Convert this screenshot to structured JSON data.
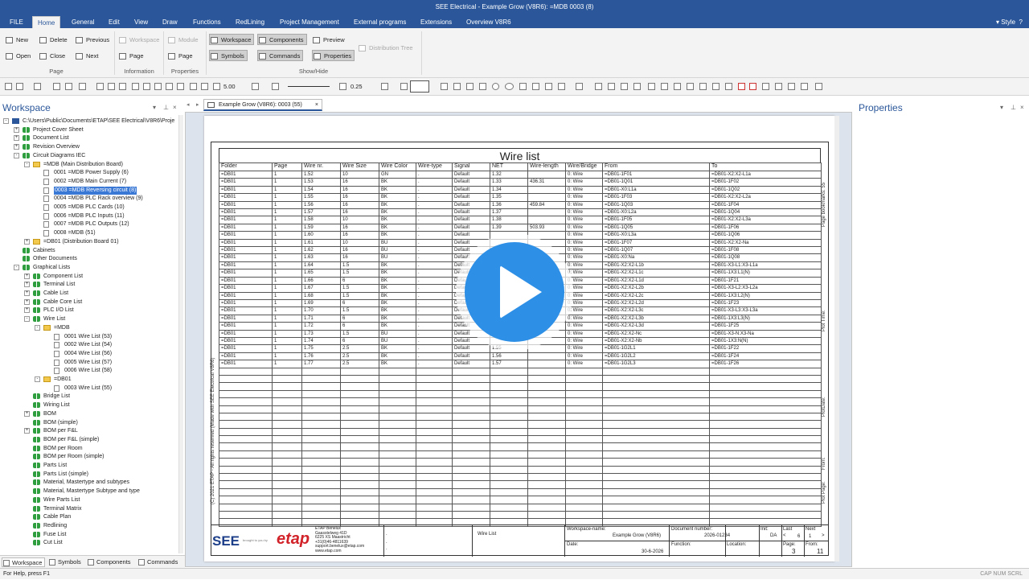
{
  "window": {
    "title": "SEE Electrical - Example Grow (V8R6): =MDB 0003 (8)"
  },
  "menu": {
    "file": "FILE",
    "tabs": [
      "Home",
      "General",
      "Edit",
      "View",
      "Draw",
      "Functions",
      "RedLining",
      "Project Management",
      "External programs",
      "Extensions",
      "Overview V8R6"
    ],
    "style": "Style"
  },
  "ribbon": {
    "page": {
      "new": "New",
      "delete": "Delete",
      "previous": "Previous",
      "open": "Open",
      "close": "Close",
      "next": "Next",
      "label": "Page"
    },
    "information": {
      "workspace": "Workspace",
      "page": "Page",
      "label": "Information"
    },
    "properties": {
      "module": "Module",
      "page": "Page",
      "label": "Properties"
    },
    "showhide": {
      "workspace": "Workspace",
      "components": "Components",
      "preview": "Preview",
      "symbols": "Symbols",
      "commands": "Commands",
      "properties": "Properties",
      "distribution_tree": "Distribution Tree",
      "label": "Show/Hide"
    }
  },
  "toolbar": {
    "zoom": "5.00",
    "line_width": "0.25"
  },
  "workspace": {
    "title": "Workspace",
    "tree": [
      {
        "label": "C:\\Users\\Public\\Documents\\ETAP\\SEE Electrical\\V8R6\\Proje",
        "level": 0,
        "exp": "-",
        "icon": "ico-blue"
      },
      {
        "label": "Project Cover Sheet",
        "level": 1,
        "exp": "+",
        "icon": "ico-green"
      },
      {
        "label": "Document List",
        "level": 1,
        "exp": "+",
        "icon": "ico-green"
      },
      {
        "label": "Revision Overview",
        "level": 1,
        "exp": "+",
        "icon": "ico-green"
      },
      {
        "label": "Circuit Diagrams IEC",
        "level": 1,
        "exp": "-",
        "icon": "ico-green"
      },
      {
        "label": "=MDB (Main Distribution Board)",
        "level": 2,
        "exp": "-",
        "icon": "ico-folder"
      },
      {
        "label": "0001 =MDB Power Supply (6)",
        "level": 3,
        "exp": "",
        "icon": "ico-page"
      },
      {
        "label": "0002 =MDB Main Current (7)",
        "level": 3,
        "exp": "",
        "icon": "ico-page"
      },
      {
        "label": "0003 =MDB Reversing circuit (8)",
        "level": 3,
        "exp": "",
        "icon": "ico-page",
        "selected": true
      },
      {
        "label": "0004 =MDB PLC Rack overview (9)",
        "level": 3,
        "exp": "",
        "icon": "ico-page"
      },
      {
        "label": "0005 =MDB PLC Cards (10)",
        "level": 3,
        "exp": "",
        "icon": "ico-page"
      },
      {
        "label": "0006 =MDB PLC Inputs (11)",
        "level": 3,
        "exp": "",
        "icon": "ico-page"
      },
      {
        "label": "0007 =MDB PLC Outputs (12)",
        "level": 3,
        "exp": "",
        "icon": "ico-page"
      },
      {
        "label": "0008 =MDB (51)",
        "level": 3,
        "exp": "",
        "icon": "ico-page"
      },
      {
        "label": "=DB01 (Distribution Board 01)",
        "level": 2,
        "exp": "+",
        "icon": "ico-folder"
      },
      {
        "label": "Cabinets",
        "level": 1,
        "exp": "",
        "icon": "ico-green"
      },
      {
        "label": "Other Documents",
        "level": 1,
        "exp": "",
        "icon": "ico-green"
      },
      {
        "label": "Graphical Lists",
        "level": 1,
        "exp": "-",
        "icon": "ico-green"
      },
      {
        "label": "Component List",
        "level": 2,
        "exp": "+",
        "icon": "ico-green"
      },
      {
        "label": "Terminal List",
        "level": 2,
        "exp": "+",
        "icon": "ico-green"
      },
      {
        "label": "Cable List",
        "level": 2,
        "exp": "+",
        "icon": "ico-green"
      },
      {
        "label": "Cable Core List",
        "level": 2,
        "exp": "+",
        "icon": "ico-green"
      },
      {
        "label": "PLC I/O List",
        "level": 2,
        "exp": "+",
        "icon": "ico-green"
      },
      {
        "label": "Wire List",
        "level": 2,
        "exp": "-",
        "icon": "ico-green"
      },
      {
        "label": "=MDB",
        "level": 3,
        "exp": "-",
        "icon": "ico-folder"
      },
      {
        "label": "0001 Wire List (53)",
        "level": 4,
        "exp": "",
        "icon": "ico-page"
      },
      {
        "label": "0002 Wire List (54)",
        "level": 4,
        "exp": "",
        "icon": "ico-page"
      },
      {
        "label": "0004 Wire List (56)",
        "level": 4,
        "exp": "",
        "icon": "ico-page"
      },
      {
        "label": "0005 Wire List (57)",
        "level": 4,
        "exp": "",
        "icon": "ico-page"
      },
      {
        "label": "0006 Wire List (58)",
        "level": 4,
        "exp": "",
        "icon": "ico-page"
      },
      {
        "label": "=DB01",
        "level": 3,
        "exp": "-",
        "icon": "ico-folder"
      },
      {
        "label": "0003 Wire List (55)",
        "level": 4,
        "exp": "",
        "icon": "ico-page"
      },
      {
        "label": "Bridge List",
        "level": 2,
        "exp": "",
        "icon": "ico-green"
      },
      {
        "label": "Wiring List",
        "level": 2,
        "exp": "",
        "icon": "ico-green"
      },
      {
        "label": "BOM",
        "level": 2,
        "exp": "+",
        "icon": "ico-green"
      },
      {
        "label": "BOM (simple)",
        "level": 2,
        "exp": "",
        "icon": "ico-green"
      },
      {
        "label": "BOM per F&L",
        "level": 2,
        "exp": "+",
        "icon": "ico-green"
      },
      {
        "label": "BOM per F&L (simple)",
        "level": 2,
        "exp": "",
        "icon": "ico-green"
      },
      {
        "label": "BOM per Room",
        "level": 2,
        "exp": "",
        "icon": "ico-green"
      },
      {
        "label": "BOM per Room (simple)",
        "level": 2,
        "exp": "",
        "icon": "ico-green"
      },
      {
        "label": "Parts List",
        "level": 2,
        "exp": "",
        "icon": "ico-green"
      },
      {
        "label": "Parts List (simple)",
        "level": 2,
        "exp": "",
        "icon": "ico-green"
      },
      {
        "label": "Material, Mastertype and subtypes",
        "level": 2,
        "exp": "",
        "icon": "ico-green"
      },
      {
        "label": "Material, Mastertype Subtype and type",
        "level": 2,
        "exp": "",
        "icon": "ico-green"
      },
      {
        "label": "Wire Parts List",
        "level": 2,
        "exp": "",
        "icon": "ico-green"
      },
      {
        "label": "Terminal Matrix",
        "level": 2,
        "exp": "",
        "icon": "ico-green"
      },
      {
        "label": "Cable Plan",
        "level": 2,
        "exp": "",
        "icon": "ico-green"
      },
      {
        "label": "Redlining",
        "level": 2,
        "exp": "",
        "icon": "ico-green"
      },
      {
        "label": "Fuse List",
        "level": 2,
        "exp": "",
        "icon": "ico-green"
      },
      {
        "label": "Cut List",
        "level": 2,
        "exp": "",
        "icon": "ico-green"
      }
    ]
  },
  "bottom_tabs": [
    "Workspace",
    "Symbols",
    "Components",
    "Commands"
  ],
  "document": {
    "tab": "Example Grow (V8R6): 0003 (55)"
  },
  "properties": {
    "title": "Properties"
  },
  "wirelist": {
    "title": "Wire list",
    "headers": [
      "Folder",
      "Page",
      "Wire nr.",
      "Wire Size",
      "Wire Color",
      "Wire-type",
      "Signal",
      "NET",
      "Wire-length",
      "Wire/Bridge",
      "From",
      "To"
    ],
    "rows": [
      [
        "=DB01",
        "1",
        "1.52",
        "10",
        "GN",
        ".",
        "Default",
        "1.32",
        "",
        "0: Wire",
        "=DB01-1F01",
        "=DB01-X2:X2-L1a"
      ],
      [
        "=DB01",
        "1",
        "1.53",
        "16",
        "BK",
        ".",
        "Default",
        "1.33",
        "436.31",
        "0: Wire",
        "=DB01-1Q01",
        "=DB01-1F02"
      ],
      [
        "=DB01",
        "1",
        "1.54",
        "16",
        "BK",
        ".",
        "Default",
        "1.34",
        "",
        "0: Wire",
        "=DB01-X0:L1a",
        "=DB01-1Q02"
      ],
      [
        "=DB01",
        "1",
        "1.55",
        "16",
        "BK",
        ".",
        "Default",
        "1.35",
        "",
        "0: Wire",
        "=DB01-1F03",
        "=DB01-X2:X2-L2a"
      ],
      [
        "=DB01",
        "1",
        "1.56",
        "16",
        "BK",
        ".",
        "Default",
        "1.36",
        "459.84",
        "0: Wire",
        "=DB01-1Q03",
        "=DB01-1F04"
      ],
      [
        "=DB01",
        "1",
        "1.57",
        "16",
        "BK",
        ".",
        "Default",
        "1.37",
        "",
        "0: Wire",
        "=DB01-X0:L2a",
        "=DB01-1Q04"
      ],
      [
        "=DB01",
        "1",
        "1.58",
        "10",
        "BK",
        ".",
        "Default",
        "1.38",
        "",
        "0: Wire",
        "=DB01-1F05",
        "=DB01-X2:X2-L3a"
      ],
      [
        "=DB01",
        "1",
        "1.59",
        "16",
        "BK",
        ".",
        "Default",
        "1.39",
        "503.93",
        "0: Wire",
        "=DB01-1Q05",
        "=DB01-1F06"
      ],
      [
        "=DB01",
        "1",
        "1.60",
        "16",
        "BK",
        ".",
        "Default",
        "",
        "",
        "0: Wire",
        "=DB01-X0:L3a",
        "=DB01-1Q06"
      ],
      [
        "=DB01",
        "1",
        "1.61",
        "10",
        "BU",
        ".",
        "Default",
        "",
        "",
        "0: Wire",
        "=DB01-1F07",
        "=DB01-X2:X2-Na"
      ],
      [
        "=DB01",
        "1",
        "1.62",
        "16",
        "BU",
        ".",
        "Default",
        "",
        "",
        "0: Wire",
        "=DB01-1Q07",
        "=DB01-1F08"
      ],
      [
        "=DB01",
        "1",
        "1.63",
        "16",
        "BU",
        ".",
        "Default",
        "",
        "",
        "0: Wire",
        "=DB01-X0:Na",
        "=DB01-1Q08"
      ],
      [
        "=DB01",
        "1",
        "1.64",
        "1.5",
        "BK",
        ".",
        "Default",
        "",
        "",
        "0: Wire",
        "=DB01-X2:X2-L1b",
        "=DB01-X3-L1:X3-L1a"
      ],
      [
        "=DB01",
        "1",
        "1.65",
        "1.5",
        "BK",
        ".",
        "Default",
        "",
        "",
        "0: Wire",
        "=DB01-X2:X2-L1c",
        "=DB01-1X3:L1(N)"
      ],
      [
        "=DB01",
        "1",
        "1.66",
        "6",
        "BK",
        ".",
        "Default",
        "",
        "",
        "0: Wire",
        "=DB01-X2:X2-L1d",
        "=DB01-1F21"
      ],
      [
        "=DB01",
        "1",
        "1.67",
        "1.5",
        "BK",
        ".",
        "Default",
        "",
        "",
        "0: Wire",
        "=DB01-X2:X2-L2b",
        "=DB01-X3-L2:X3-L2a"
      ],
      [
        "=DB01",
        "1",
        "1.68",
        "1.5",
        "BK",
        ".",
        "Default",
        "",
        "",
        "0: Wire",
        "=DB01-X2:X2-L2c",
        "=DB01-1X3:L2(N)"
      ],
      [
        "=DB01",
        "1",
        "1.69",
        "6",
        "BK",
        ".",
        "Default",
        "",
        "",
        "0: Wire",
        "=DB01-X2:X2-L2d",
        "=DB01-1F23"
      ],
      [
        "=DB01",
        "1",
        "1.70",
        "1.5",
        "BK",
        ".",
        "Default",
        "",
        "",
        "0: Wire",
        "=DB01-X2:X2-L3c",
        "=DB01-X3-L3:X3-L3a"
      ],
      [
        "=DB01",
        "1",
        "1.71",
        "6",
        "BK",
        ".",
        "Default",
        "",
        "",
        "0: Wire",
        "=DB01-X2:X2-L3b",
        "=DB01-1X3:L3(N)"
      ],
      [
        "=DB01",
        "1",
        "1.72",
        "6",
        "BK",
        ".",
        "Default",
        "",
        "",
        "0: Wire",
        "=DB01-X2:X2-L3d",
        "=DB01-1F25"
      ],
      [
        "=DB01",
        "1",
        "1.73",
        "1.5",
        "BU",
        ".",
        "Default",
        "",
        "",
        "0: Wire",
        "=DB01-X2:X2-Nc",
        "=DB01-X3-N:X3-Na"
      ],
      [
        "=DB01",
        "1",
        "1.74",
        "6",
        "BU",
        ".",
        "Default",
        "",
        "",
        "0: Wire",
        "=DB01-X2:X2-Nb",
        "=DB01-1X3:N(N)"
      ],
      [
        "=DB01",
        "1",
        "1.75",
        "2.5",
        "BK",
        ".",
        "Default",
        "1.55",
        "",
        "0: Wire",
        "=DB01-1G2L1",
        "=DB01-1F22"
      ],
      [
        "=DB01",
        "1",
        "1.76",
        "2.5",
        "BK",
        ".",
        "Default",
        "1.56",
        "",
        "0: Wire",
        "=DB01-1G2L2",
        "=DB01-1F24"
      ],
      [
        "=DB01",
        "1",
        "1.77",
        "2.5",
        "BK",
        ".",
        "Default",
        "1.57",
        "",
        "0: Wire",
        "=DB01-1G2L3",
        "=DB01-1F26"
      ]
    ],
    "empty_rows": 21,
    "left_copyright": "(C) 2021 ETAP - All rights reserved (Made with SEE Electrical V8R6)",
    "right_labels": {
      "bookmark": "Page bookmarks: 55",
      "plot_time": "Plot Time:",
      "plot_date": "PlotDate:",
      "from": "From:",
      "plot_page": "Plot Page:"
    }
  },
  "titleblock": {
    "see": "SEE",
    "brought": "brought to you by",
    "etap": "etap",
    "address": [
      "ETAP Benelux",
      "Gaasstelweg 41D",
      "6225 XS Maastricht",
      "+31(0)46-4811639",
      "support.benelux@etap.com",
      "www.etap.com"
    ],
    "dots": [
      ".",
      ".",
      "."
    ],
    "doc": "Wire List",
    "workspace_name_label": "Workspace-name:",
    "workspace_name": "Example Grow (V8R6)",
    "date_label": "Date:",
    "date": "30-6-2026",
    "docnum_label": "Document number:",
    "docnum": "2026-01234",
    "function_label": "Function:",
    "location_label": "Location:",
    "init_label": "Init:",
    "init": "DA",
    "last_label": "Last",
    "last": "6",
    "next_label": "Next",
    "next": "1",
    "page_label": "Page:",
    "page": "3",
    "from_label": "From:",
    "from": "11"
  },
  "status": {
    "help": "For Help, press F1",
    "right": "CAP NUM SCRL"
  }
}
